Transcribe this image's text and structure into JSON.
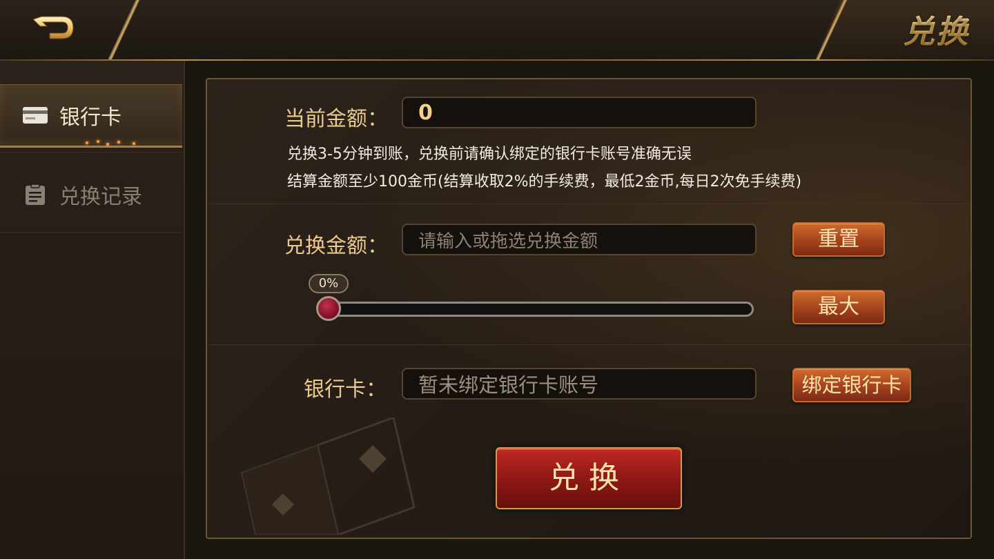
{
  "header": {
    "title": "兑换",
    "back_icon": "back-arrow-icon"
  },
  "sidebar": {
    "items": [
      {
        "label": "银行卡",
        "icon": "bank-card-icon",
        "active": true
      },
      {
        "label": "兑换记录",
        "icon": "clipboard-icon",
        "active": false
      }
    ]
  },
  "form": {
    "current_amount_label": "当前金额：",
    "current_amount_value": "0",
    "info_line1": "兑换3-5分钟到账，兑换前请确认绑定的银行卡账号准确无误",
    "info_line2": "结算金额至少100金币(结算收取2%的手续费，最低2金币,每日2次免手续费)",
    "exchange_amount_label": "兑换金额：",
    "exchange_amount_placeholder": "请输入或拖选兑换金额",
    "reset_label": "重置",
    "max_label": "最大",
    "slider_value_text": "0%",
    "slider_fraction": 0,
    "bank_card_label": "银行卡：",
    "bank_card_value": "暂未绑定银行卡账号",
    "bind_card_label": "绑定银行卡",
    "submit_label": "兑换"
  },
  "colors": {
    "accent_gold": "#ecc98c",
    "button_orange": "#a8451e",
    "submit_red": "#931a16",
    "slider_thumb": "#8a1230"
  }
}
